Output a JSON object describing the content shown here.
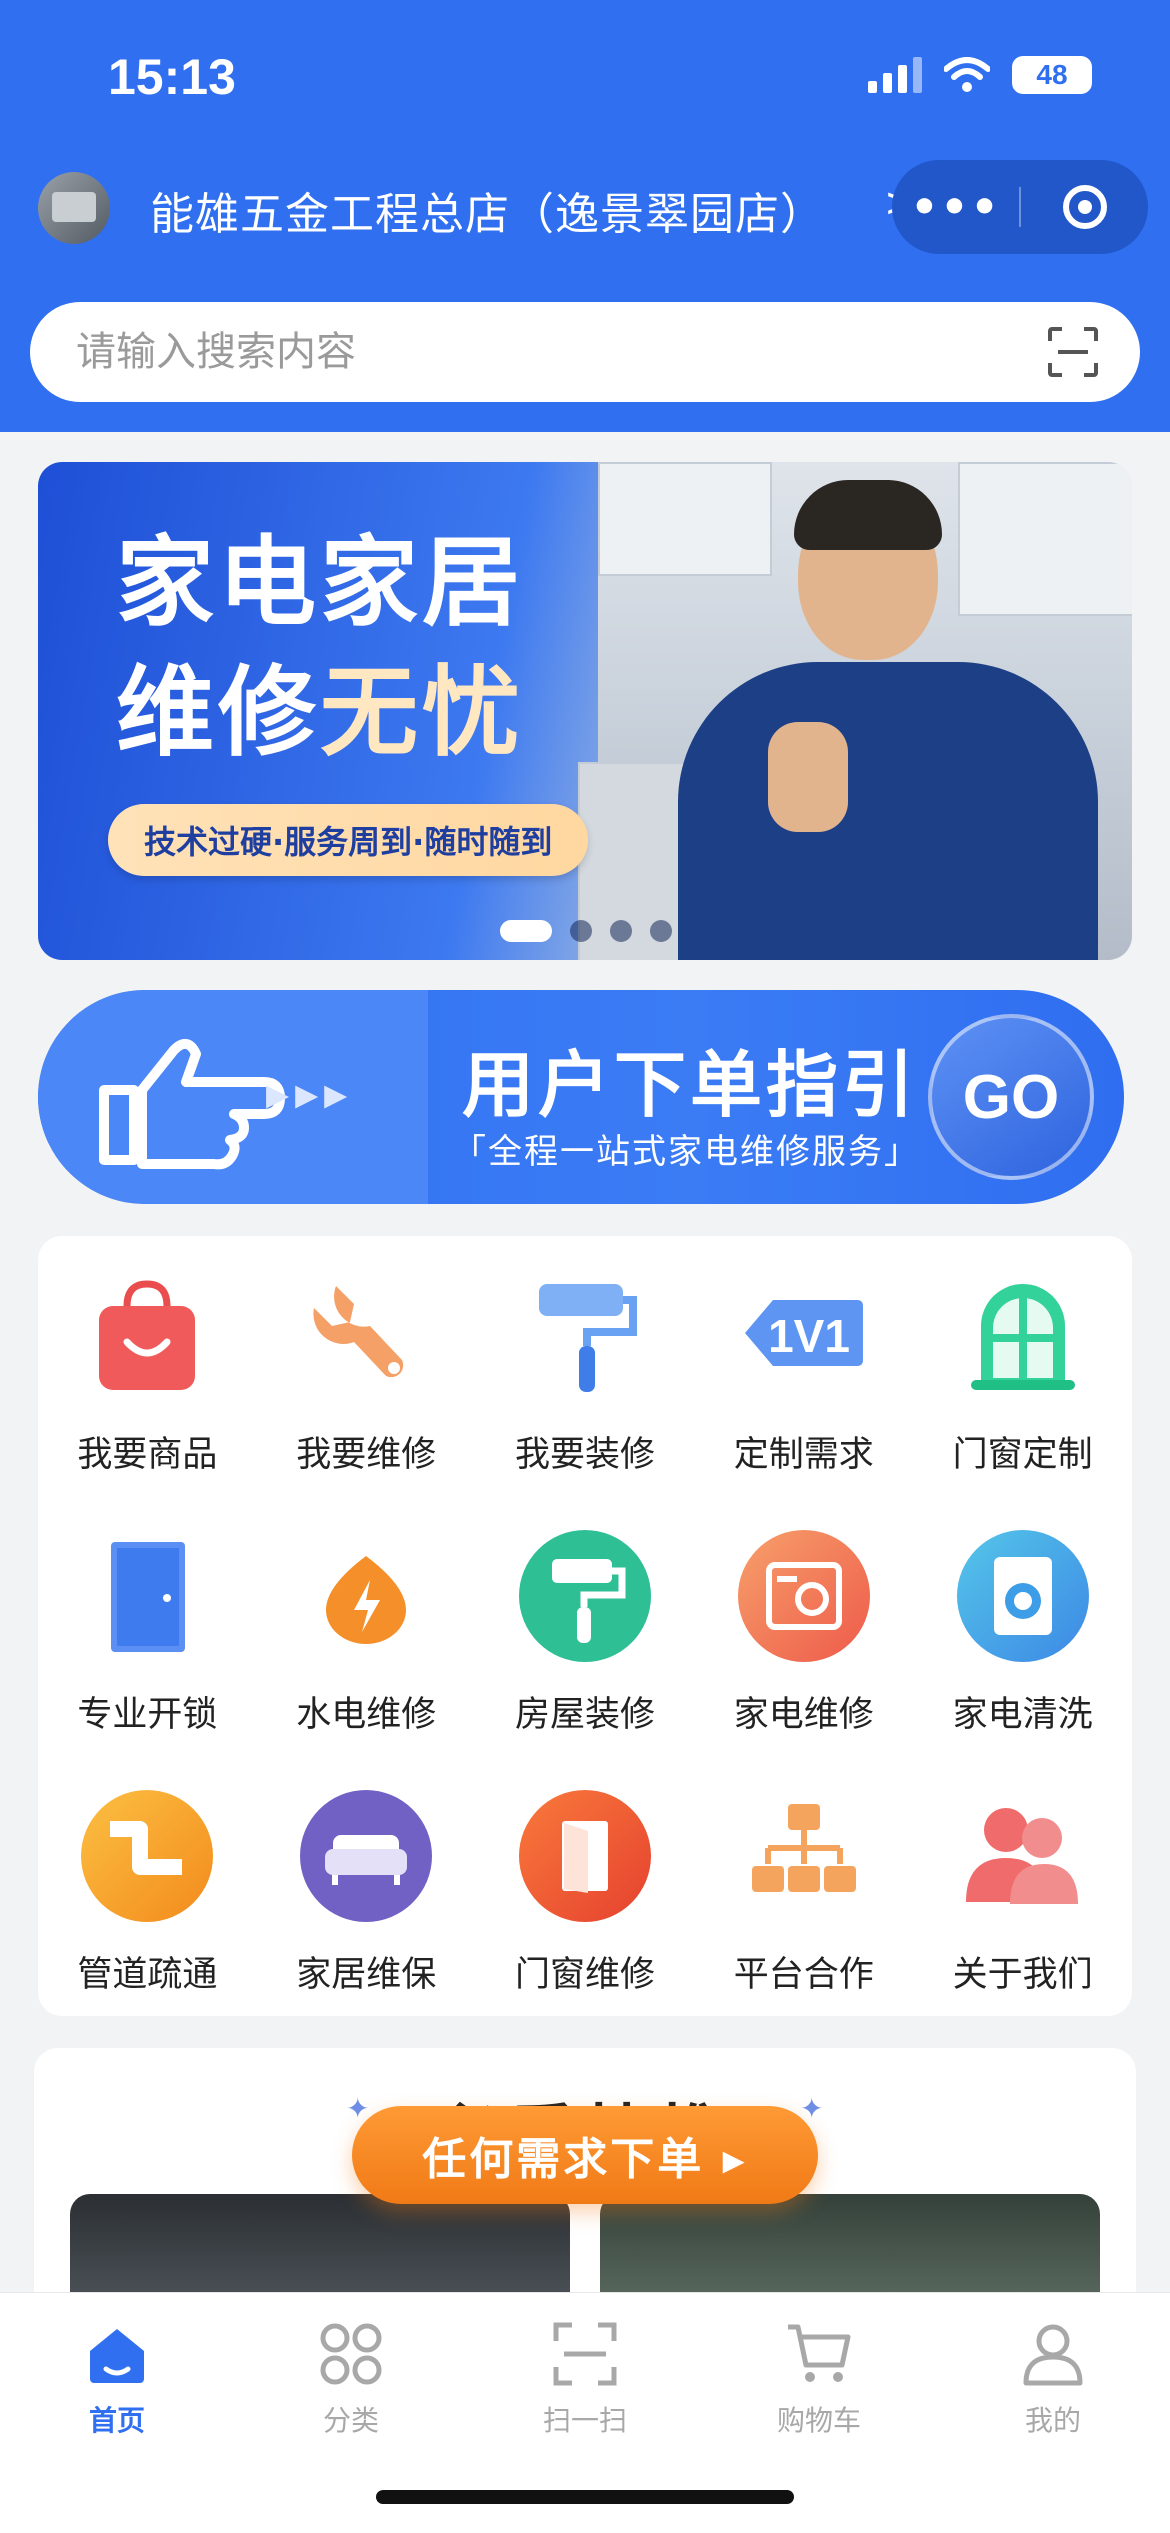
{
  "status_bar": {
    "time": "15:13",
    "battery": "48"
  },
  "header": {
    "store_name": "能雄五金工程总店（逸景翠园店）",
    "store_arrow": ">",
    "capsule_more": "•••"
  },
  "search": {
    "placeholder": "请输入搜索内容"
  },
  "banner": {
    "title_line1": "家电家居",
    "title_line2_a": "维修",
    "title_line2_b": "无忧",
    "tagline": "技术过硬·服务周到·随时随到",
    "slides_total": 4,
    "active_slide": 1
  },
  "guide": {
    "title": "用户下单指引",
    "subtitle": "「全程一站式家电维修服务」",
    "go_label": "GO",
    "arrows": "▸▸▸"
  },
  "services": [
    {
      "label": "我要商品",
      "icon": "shopping-bag-icon"
    },
    {
      "label": "我要维修",
      "icon": "wrench-icon"
    },
    {
      "label": "我要装修",
      "icon": "paint-roller-icon"
    },
    {
      "label": "定制需求",
      "icon": "one-on-one-tag-icon"
    },
    {
      "label": "门窗定制",
      "icon": "window-icon"
    },
    {
      "label": "专业开锁",
      "icon": "door-icon"
    },
    {
      "label": "水电维修",
      "icon": "lightning-drop-icon"
    },
    {
      "label": "房屋装修",
      "icon": "roller-circle-icon"
    },
    {
      "label": "家电维修",
      "icon": "appliance-icon"
    },
    {
      "label": "家电清洗",
      "icon": "washing-machine-icon"
    },
    {
      "label": "管道疏通",
      "icon": "pipe-icon"
    },
    {
      "label": "家居维保",
      "icon": "sofa-icon"
    },
    {
      "label": "门窗维修",
      "icon": "door-circle-icon"
    },
    {
      "label": "平台合作",
      "icon": "org-chart-icon"
    },
    {
      "label": "关于我们",
      "icon": "users-icon"
    }
  ],
  "lower": {
    "heading": "必看技推",
    "order_button": "任何需求下单 ▸"
  },
  "tabbar": {
    "items": [
      {
        "label": "首页",
        "icon": "home-icon",
        "active": true
      },
      {
        "label": "分类",
        "icon": "category-icon",
        "active": false
      },
      {
        "label": "扫一扫",
        "icon": "scan-icon",
        "active": false
      },
      {
        "label": "购物车",
        "icon": "cart-icon",
        "active": false
      },
      {
        "label": "我的",
        "icon": "profile-icon",
        "active": false
      }
    ]
  },
  "colors": {
    "primary": "#2f6ff0",
    "accent_orange": "#f07a16",
    "tab_inactive": "#a8a8a8"
  }
}
